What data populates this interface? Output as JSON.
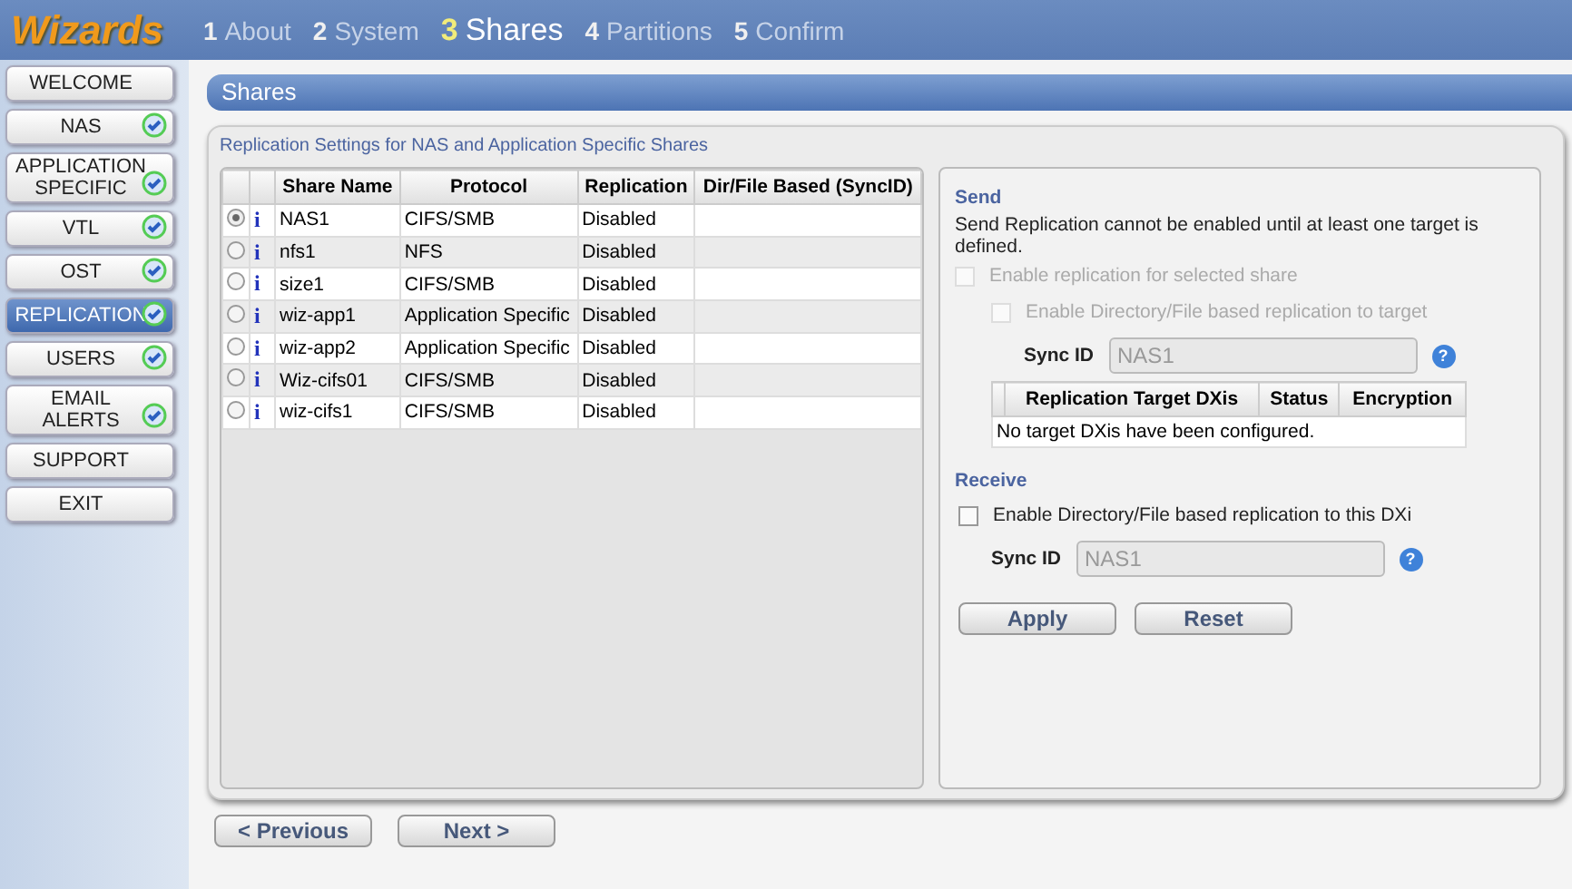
{
  "logo": "Wizards",
  "steps": [
    {
      "number": "1",
      "label": "About",
      "selected": false
    },
    {
      "number": "2",
      "label": "System",
      "selected": false
    },
    {
      "number": "3",
      "label": "Shares",
      "selected": true
    },
    {
      "number": "4",
      "label": "Partitions",
      "selected": false
    },
    {
      "number": "5",
      "label": "Confirm",
      "selected": false
    }
  ],
  "sidebar": {
    "items": [
      {
        "label": "WELCOME",
        "done": false,
        "selected": false
      },
      {
        "label": "NAS",
        "done": true,
        "selected": false
      },
      {
        "label": "APPLICATION SPECIFIC",
        "done": true,
        "selected": false
      },
      {
        "label": "VTL",
        "done": true,
        "selected": false
      },
      {
        "label": "OST",
        "done": true,
        "selected": false
      },
      {
        "label": "REPLICATION",
        "done": true,
        "selected": true
      },
      {
        "label": "USERS",
        "done": true,
        "selected": false
      },
      {
        "label": "EMAIL ALERTS",
        "done": true,
        "selected": false
      },
      {
        "label": "SUPPORT",
        "done": false,
        "selected": false
      },
      {
        "label": "EXIT",
        "done": false,
        "selected": false
      }
    ]
  },
  "page_title": "Shares",
  "panel_title": "Replication Settings for NAS and Application Specific Shares",
  "table": {
    "columns": [
      "Share Name",
      "Protocol",
      "Replication",
      "Dir/File Based (SyncID)"
    ],
    "rows": [
      {
        "selected": true,
        "info": "i",
        "cells": [
          "NAS1",
          "CIFS/SMB",
          "Disabled"
        ]
      },
      {
        "selected": false,
        "info": "i",
        "cells": [
          "nfs1",
          "NFS",
          "Disabled"
        ]
      },
      {
        "selected": false,
        "info": "i",
        "cells": [
          "size1",
          "CIFS/SMB",
          "Disabled"
        ]
      },
      {
        "selected": false,
        "info": "i",
        "cells": [
          "wiz-app1",
          "Application Specific",
          "Disabled"
        ]
      },
      {
        "selected": false,
        "info": "i",
        "cells": [
          "wiz-app2",
          "Application Specific",
          "Disabled"
        ]
      },
      {
        "selected": false,
        "info": "i",
        "cells": [
          "Wiz-cifs01",
          "CIFS/SMB",
          "Disabled"
        ]
      },
      {
        "selected": false,
        "info": "i",
        "cells": [
          "wiz-cifs1",
          "CIFS/SMB",
          "Disabled"
        ]
      }
    ]
  },
  "send": {
    "heading": "Send",
    "note": "Send Replication cannot be enabled until at least one target is defined.",
    "enable": {
      "label": "Enable replication for selected share",
      "checked": false,
      "disabled": true
    },
    "dir_enable": {
      "label": "Enable Directory/File based replication to target",
      "checked": false,
      "disabled": true
    },
    "sync_label": "Sync ID",
    "sync_value": "NAS1",
    "help": "?",
    "targets": {
      "columns": [
        "Replication Target DXis",
        "Status",
        "Encryption"
      ],
      "empty": "No target DXis have been configured."
    }
  },
  "receive": {
    "heading": "Receive",
    "dir_enable": {
      "label": "Enable Directory/File based replication to this DXi",
      "checked": false,
      "disabled": false
    },
    "sync_label": "Sync ID",
    "sync_value": "NAS1",
    "help": "?"
  },
  "actions": [
    "Apply",
    "Reset"
  ],
  "nav": [
    "< Previous",
    "Next >"
  ]
}
